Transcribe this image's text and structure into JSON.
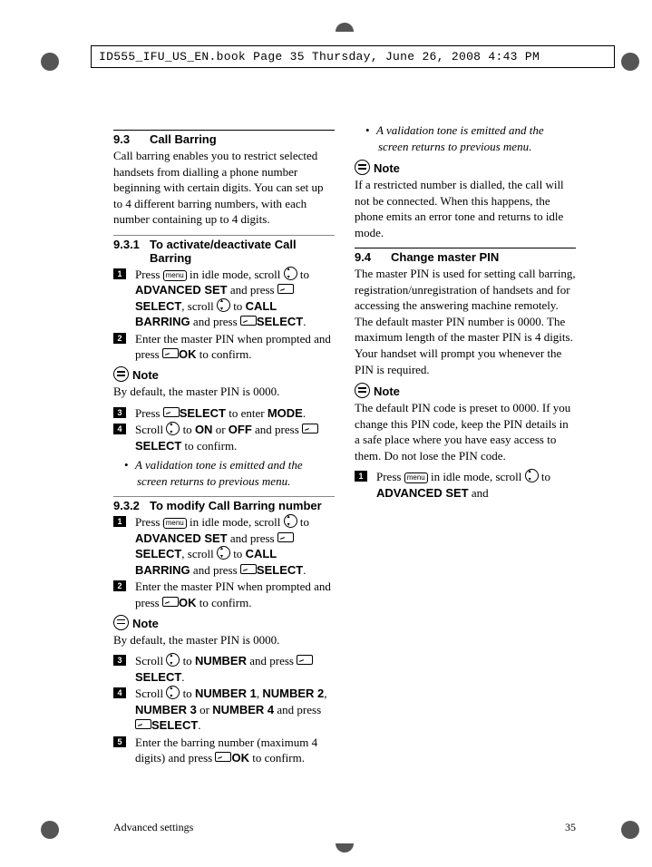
{
  "header_runner": "ID555_IFU_US_EN.book  Page 35  Thursday, June 26, 2008  4:43 PM",
  "s93": {
    "num": "9.3",
    "title": "Call Barring",
    "intro": "Call barring enables you to restrict selected handsets from dialling a phone number beginning with certain digits. You can set up to 4 different barring numbers, with each number containing up to 4 digits."
  },
  "s931": {
    "num": "9.3.1",
    "title": "To activate/deactivate Call Barring",
    "step1a": "Press ",
    "step1b": " in idle mode, scroll ",
    "step1c": " to ",
    "step1d": " and press ",
    "step1e": ", scroll ",
    "step1f": " to ",
    "step1g": " and press ",
    "adv": "ADVANCED SET",
    "sel": "SELECT",
    "cb": "CALL BARRING",
    "step2a": "Enter the master PIN when prompted and press ",
    "step2b": " to confirm.",
    "ok": "OK",
    "note_h": "Note",
    "note_t": "By default, the master PIN is 0000.",
    "step3a": "Press ",
    "step3b": " to enter ",
    "mode": "MODE",
    "step4a": "Scroll ",
    "step4b": " to ",
    "on": "ON",
    "off": "OFF",
    "or_w": " or ",
    "step4c": " and press ",
    "step4d": " to confirm.",
    "sub": "A validation tone is emitted and the screen returns to previous menu."
  },
  "s932": {
    "num": "9.3.2",
    "title": "To modify Call Barring number",
    "step1a": "Press ",
    "step1b": " in idle mode, scroll ",
    "step1c": " to ",
    "step1g": " and press ",
    "adv": "ADVANCED SET",
    "sel": "SELECT",
    "cb": "CALL BARRING",
    "step1d": " and press ",
    "step1e": ", scroll ",
    "step1f": " to ",
    "step2a": "Enter the master PIN when prompted and press ",
    "step2b": " to confirm.",
    "ok": "OK",
    "note_h": "Note",
    "note_t": "By default, the master PIN is 0000.",
    "step3a": "Scroll ",
    "step3b": " to ",
    "num_w": "NUMBER",
    "step3c": " and press ",
    "step4a": "Scroll ",
    "step4b": " to ",
    "n1": "NUMBER 1",
    "n2": "NUMBER 2",
    "n3": "NUMBER 3",
    "n4": "NUMBER 4",
    "or_w": " or ",
    "step4c": " and press ",
    "step5a": "Enter the barring number (maximum 4 digits) and press ",
    "step5b": " to confirm.",
    "sub": "A validation tone is emitted and the screen returns to previous menu.",
    "note2_h": "Note",
    "note2_t": "If a restricted number is dialled, the call will not be connected. When this happens, the phone emits an error tone and returns to idle mode."
  },
  "s94": {
    "num": "9.4",
    "title": "Change master PIN",
    "intro": "The master PIN is used for setting call barring, registration/unregistration of handsets and for accessing the answering machine remotely. The default master PIN number is 0000. The maximum length of the master PIN is 4 digits. Your handset will prompt you whenever the PIN is required.",
    "note_h": "Note",
    "note_t": "The default PIN code is preset to 0000. If you change this PIN code, keep the PIN details in a safe place where you have easy access to them. Do not lose the PIN code.",
    "step1a": "Press ",
    "step1b": " in idle mode, scroll ",
    "step1c": " to ",
    "adv": "ADVANCED SET",
    "step1d": " and"
  },
  "footer": {
    "left": "Advanced settings",
    "right": "35"
  },
  "key": {
    "menu": "menu"
  }
}
